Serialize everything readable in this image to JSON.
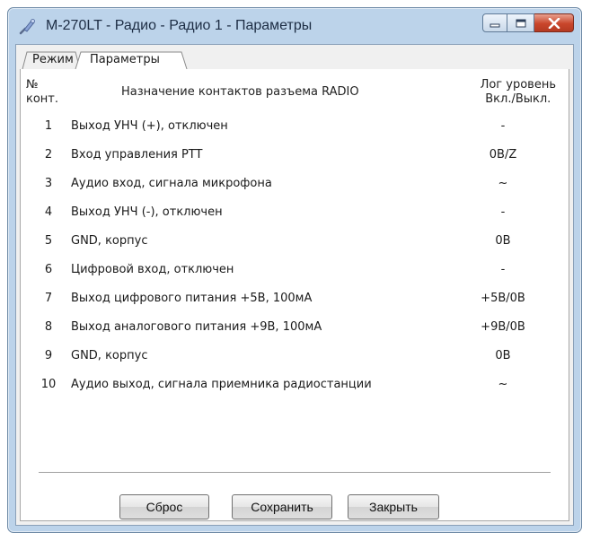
{
  "window": {
    "title": "M-270LT - Радио - Радио 1 - Параметры",
    "accent": "#bcd3ea"
  },
  "tabs": [
    {
      "label": "Режим",
      "active": false
    },
    {
      "label": "Параметры",
      "active": true
    }
  ],
  "table": {
    "header_num_1": "№",
    "header_num_2": "конт.",
    "header_desc": "Назначение контактов разъема RADIO",
    "header_level_1": "Лог уровень",
    "header_level_2": "Вкл./Выкл.",
    "rows": [
      {
        "num": "1",
        "desc": "Выход УНЧ (+), отключен",
        "val": "-"
      },
      {
        "num": "2",
        "desc": "Вход управления PTT",
        "val": "0В/Z"
      },
      {
        "num": "3",
        "desc": "Аудио вход, сигнала микрофона",
        "val": "~"
      },
      {
        "num": "4",
        "desc": "Выход УНЧ (-), отключен",
        "val": "-"
      },
      {
        "num": "5",
        "desc": "GND, корпус",
        "val": "0В"
      },
      {
        "num": "6",
        "desc": "Цифровой вход, отключен",
        "val": "-"
      },
      {
        "num": "7",
        "desc": "Выход цифрового питания +5В, 100мА",
        "val": "+5В/0В"
      },
      {
        "num": "8",
        "desc": "Выход аналогового питания +9В, 100мА",
        "val": "+9В/0В"
      },
      {
        "num": "9",
        "desc": "GND, корпус",
        "val": "0В"
      },
      {
        "num": "10",
        "desc": "Аудио выход, сигнала приемника радиостанции",
        "val": "~"
      }
    ]
  },
  "buttons": {
    "reset": "Сброс",
    "save": "Сохранить",
    "close": "Закрыть"
  }
}
